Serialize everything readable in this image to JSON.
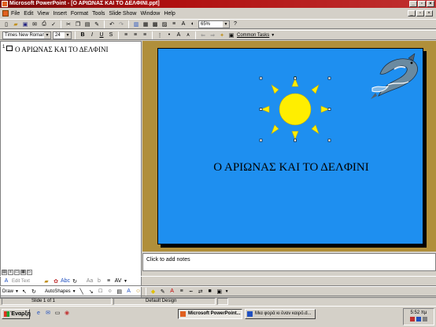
{
  "window": {
    "title": "Microsoft PowerPoint - [Ο ΑΡΙΩΝΑΣ ΚΑΙ ΤΟ ΔΕΛΦΙΝΙ.ppt]"
  },
  "menu": [
    {
      "label": "File"
    },
    {
      "label": "Edit"
    },
    {
      "label": "View"
    },
    {
      "label": "Insert"
    },
    {
      "label": "Format"
    },
    {
      "label": "Tools"
    },
    {
      "label": "Slide Show"
    },
    {
      "label": "Window"
    },
    {
      "label": "Help"
    }
  ],
  "toolbar": {
    "zoom": "65%"
  },
  "format": {
    "font": "Times New Roman",
    "size": "24",
    "common_tasks": "Common Tasks"
  },
  "outline": {
    "slide_number": "1",
    "text": "Ο ΑΡΙΩΝΑΣ ΚΑΙ ΤΟ ΔΕΛΦΙΝΙ"
  },
  "slide": {
    "title": "Ο ΑΡΙΩΝΑΣ ΚΑΙ ΤΟ ΔΕΛΦΙΝΙ",
    "background_color": "#1e8ff0",
    "sun_color": "#ffee00"
  },
  "notes": {
    "placeholder": "Click to add notes"
  },
  "picture_toolbar": {
    "edit_text": "Edit Text"
  },
  "drawing": {
    "draw": "Draw",
    "autoshapes": "AutoShapes"
  },
  "status": {
    "slide": "Slide 1 of 1",
    "design": "Default Design"
  },
  "taskbar": {
    "start": "Έναρξη",
    "tasks": [
      "Microsoft PowerPoint...",
      "Μια φορά κι έναν καιρό.d..."
    ],
    "clock": "5:52 πμ"
  }
}
